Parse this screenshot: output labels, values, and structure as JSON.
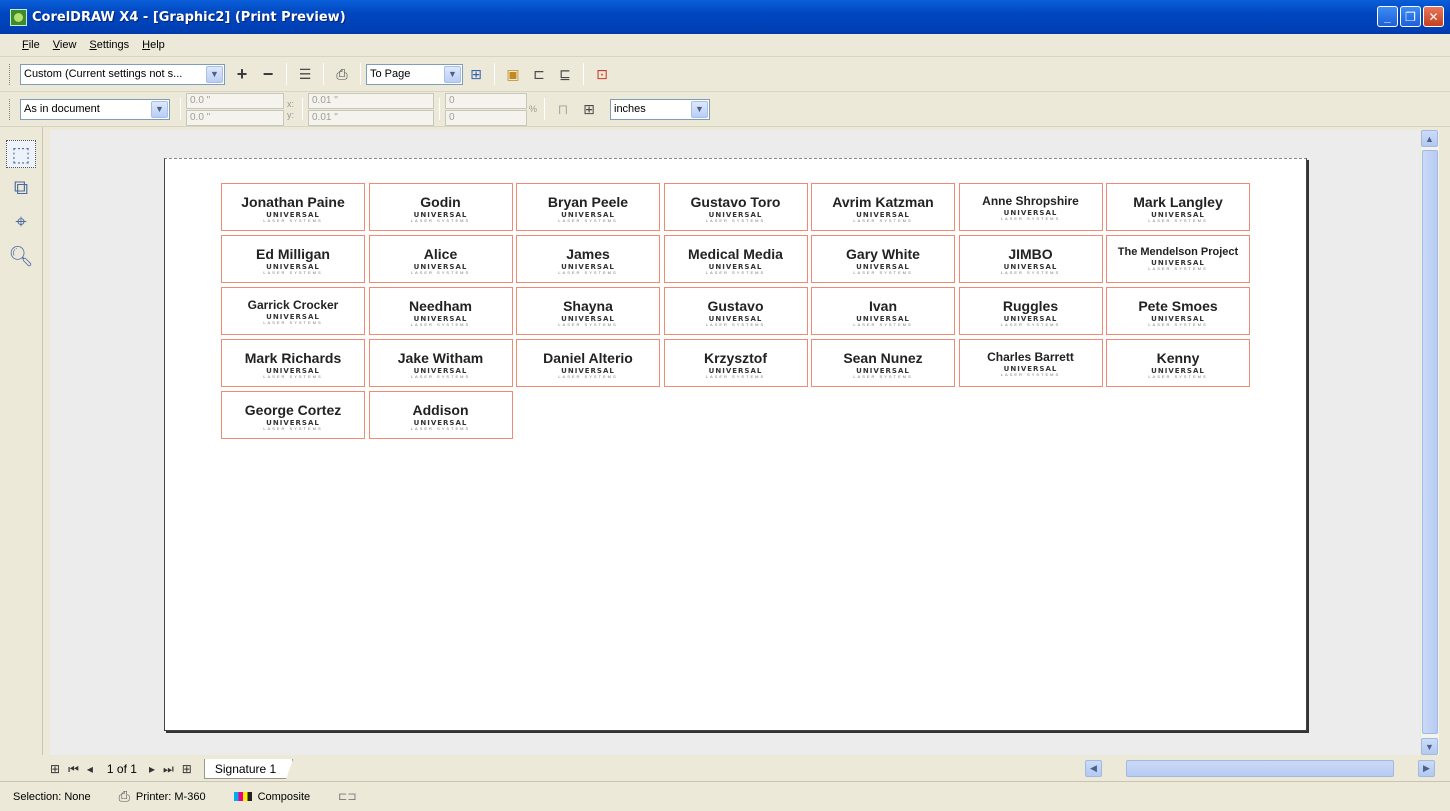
{
  "window": {
    "title": "CorelDRAW X4 - [Graphic2] (Print Preview)",
    "minimize_glyph": "_",
    "restore_glyph": "❐",
    "close_glyph": "✕"
  },
  "menu": [
    "File",
    "View",
    "Settings",
    "Help"
  ],
  "toolbar1": {
    "preset": "Custom (Current settings not s...",
    "zoom": "To Page"
  },
  "toolbar2": {
    "position": "As in document",
    "pos_x": "0.0 \"",
    "pos_y": "0.0 \"",
    "label_x": "x:",
    "label_y": "y:",
    "width": "0.01 \"",
    "height": "0.01 \"",
    "scale_w": "0",
    "scale_h": "0",
    "pct": "%",
    "units": "inches"
  },
  "labels": [
    {
      "name": "Jonathan Paine"
    },
    {
      "name": "Godin"
    },
    {
      "name": "Bryan Peele"
    },
    {
      "name": "Gustavo Toro"
    },
    {
      "name": "Avrim Katzman"
    },
    {
      "name": "Anne Shropshire"
    },
    {
      "name": "Mark Langley"
    },
    {
      "name": "Ed Milligan"
    },
    {
      "name": "Alice"
    },
    {
      "name": "James"
    },
    {
      "name": "Medical Media"
    },
    {
      "name": "Gary White"
    },
    {
      "name": "JIMBO"
    },
    {
      "name": "The Mendelson Project"
    },
    {
      "name": "Garrick Crocker"
    },
    {
      "name": "Needham"
    },
    {
      "name": "Shayna"
    },
    {
      "name": "Gustavo"
    },
    {
      "name": "Ivan"
    },
    {
      "name": "Ruggles"
    },
    {
      "name": "Pete Smoes"
    },
    {
      "name": "Mark Richards"
    },
    {
      "name": "Jake Witham"
    },
    {
      "name": "Daniel Alterio"
    },
    {
      "name": "Krzysztof"
    },
    {
      "name": "Sean Nunez"
    },
    {
      "name": "Charles Barrett"
    },
    {
      "name": "Kenny"
    },
    {
      "name": "George Cortez"
    },
    {
      "name": "Addison"
    }
  ],
  "logo": {
    "main": "UNIVERSAL",
    "sub": "LASER SYSTEMS"
  },
  "nav": {
    "page_indicator": "1 of 1",
    "tab": "Signature 1"
  },
  "status": {
    "selection": "Selection: None",
    "printer": "Printer: M-360",
    "color_mode": "Composite"
  }
}
